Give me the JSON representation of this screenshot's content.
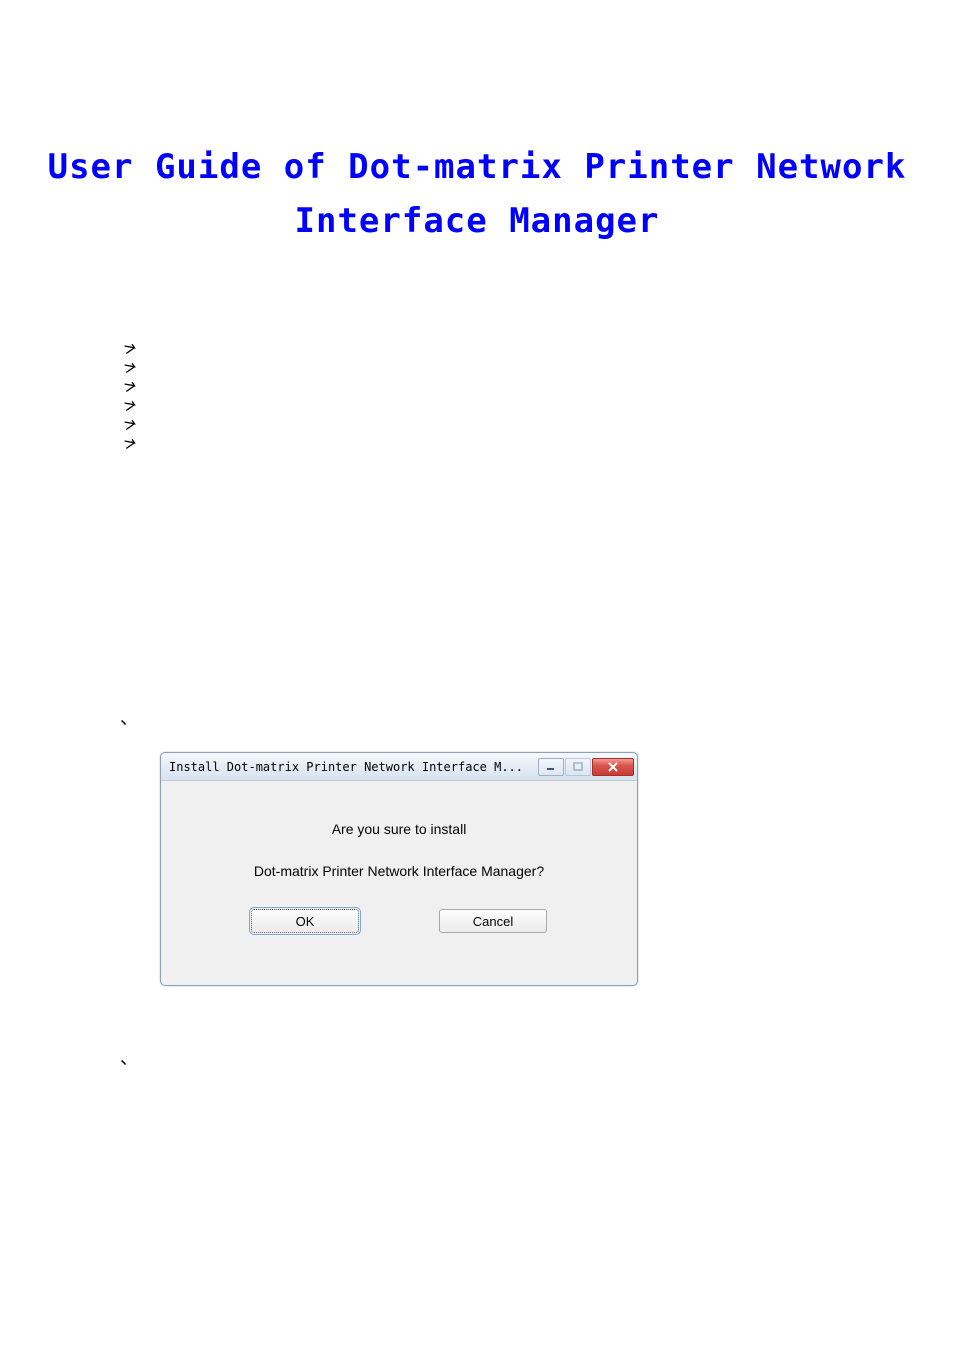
{
  "title": {
    "line1": "User Guide of Dot-matrix Printer Network",
    "line2": "Interface Manager"
  },
  "accents": {
    "mark": "、"
  },
  "dialog": {
    "title": "Install Dot-matrix Printer Network Interface M...",
    "line1": "Are you sure to install",
    "line2": "Dot-matrix Printer Network Interface Manager?",
    "ok": "OK",
    "cancel": "Cancel"
  }
}
